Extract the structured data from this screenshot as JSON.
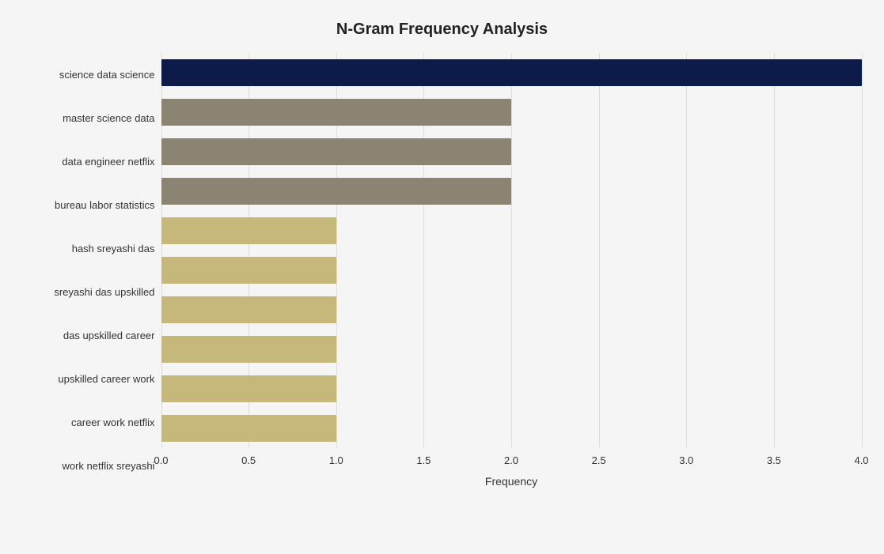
{
  "chart": {
    "title": "N-Gram Frequency Analysis",
    "x_axis_label": "Frequency",
    "x_ticks": [
      "0.0",
      "0.5",
      "1.0",
      "1.5",
      "2.0",
      "2.5",
      "3.0",
      "3.5",
      "4.0"
    ],
    "x_tick_values": [
      0,
      0.5,
      1,
      1.5,
      2,
      2.5,
      3,
      3.5,
      4
    ],
    "max_value": 4.0,
    "bars": [
      {
        "label": "science data science",
        "value": 4.0,
        "color": "dark-blue"
      },
      {
        "label": "master science data",
        "value": 2.0,
        "color": "gray"
      },
      {
        "label": "data engineer netflix",
        "value": 2.0,
        "color": "gray"
      },
      {
        "label": "bureau labor statistics",
        "value": 2.0,
        "color": "gray"
      },
      {
        "label": "hash sreyashi das",
        "value": 1.0,
        "color": "tan"
      },
      {
        "label": "sreyashi das upskilled",
        "value": 1.0,
        "color": "tan"
      },
      {
        "label": "das upskilled career",
        "value": 1.0,
        "color": "tan"
      },
      {
        "label": "upskilled career work",
        "value": 1.0,
        "color": "tan"
      },
      {
        "label": "career work netflix",
        "value": 1.0,
        "color": "tan"
      },
      {
        "label": "work netflix sreyashi",
        "value": 1.0,
        "color": "tan"
      }
    ]
  }
}
